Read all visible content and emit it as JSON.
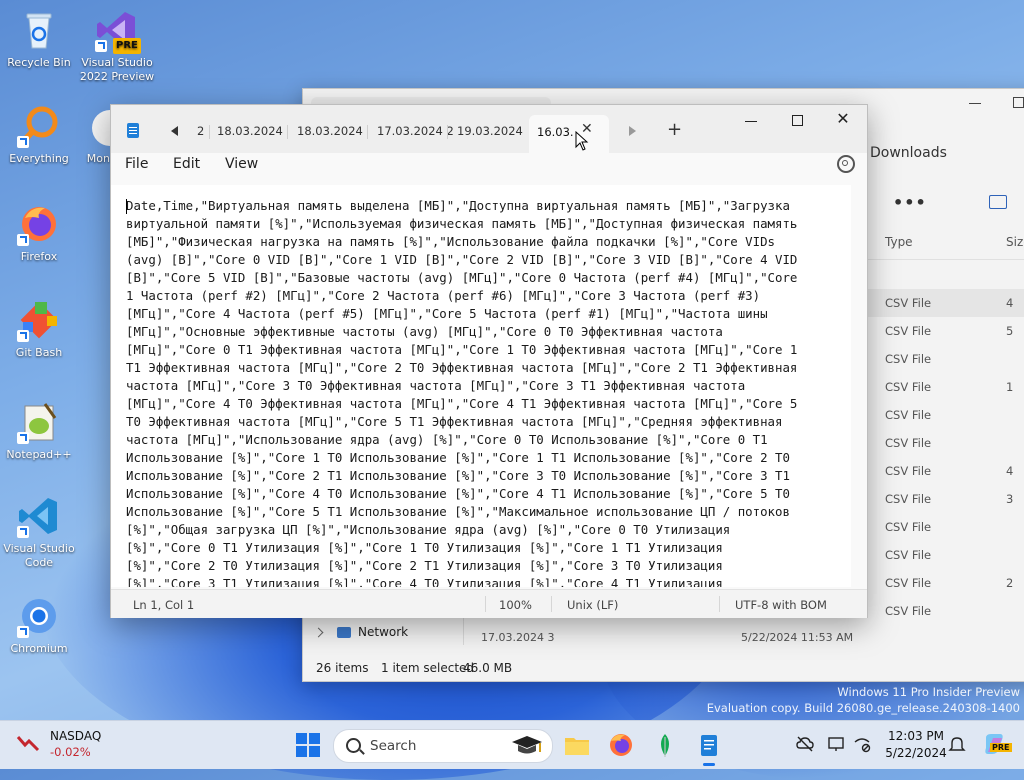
{
  "desktop": {
    "icons": [
      {
        "label": "Recycle Bin"
      },
      {
        "label": "Visual Studio 2022 Preview",
        "badge": "PRE"
      },
      {
        "label": "Everything"
      },
      {
        "label": "Mon"
      },
      {
        "label": "Firefox"
      },
      {
        "label": "Git Bash"
      },
      {
        "label": "Notepad++"
      },
      {
        "label": "Visual Studio Code"
      },
      {
        "label": "Chromium"
      }
    ]
  },
  "explorer": {
    "breadcrumb_location": "Downloads",
    "column_type": "Type",
    "column_size": "Size",
    "rows": [
      {
        "type": "CSV File",
        "size": "4"
      },
      {
        "type": "CSV File",
        "size": "5"
      },
      {
        "type": "CSV File",
        "size": ""
      },
      {
        "type": "CSV File",
        "size": "1"
      },
      {
        "type": "CSV File",
        "size": ""
      },
      {
        "type": "CSV File",
        "size": ""
      },
      {
        "type": "CSV File",
        "size": "4"
      },
      {
        "type": "CSV File",
        "size": "3"
      },
      {
        "type": "CSV File",
        "size": ""
      },
      {
        "type": "CSV File",
        "size": ""
      },
      {
        "type": "CSV File",
        "size": "2"
      },
      {
        "type": "CSV File",
        "size": ""
      }
    ],
    "nav_network": "Network",
    "partial_row": "17.03.2024 3",
    "partial_row_date": "5/22/2024 11:53 AM",
    "status_items": "26 items",
    "status_selected": "1 item selected",
    "status_size": "46.0 MB"
  },
  "notepad": {
    "tabs": [
      {
        "label": "2"
      },
      {
        "label": "18.03.2024"
      },
      {
        "label": "18.03.2024"
      },
      {
        "label": "17.03.2024 2"
      },
      {
        "label": "19.03.2024"
      }
    ],
    "active_tab": "16.03.",
    "close_glyph": "✕",
    "plus_glyph": "+",
    "close_window_glyph": "✕",
    "menu": {
      "file": "File",
      "edit": "Edit",
      "view": "View"
    },
    "content_lines": [
      "Date,Time,\"Виртуальная память выделена [МБ]\",\"Доступна виртуальная память [МБ]\",\"Загрузка",
      "виртуальной памяти [%]\",\"Используемая физическая память [МБ]\",\"Доступная физическая память",
      "[МБ]\",\"Физическая нагрузка на память [%]\",\"Использование файла подкачки [%]\",\"Core VIDs",
      "(avg) [В]\",\"Core 0 VID [В]\",\"Core 1 VID [В]\",\"Core 2 VID [В]\",\"Core 3 VID [В]\",\"Core 4 VID",
      "[В]\",\"Core 5 VID [В]\",\"Базовые частоты (avg) [МГц]\",\"Core 0 Частота (perf #4) [МГц]\",\"Core",
      "1 Частота (perf #2) [МГц]\",\"Core 2 Частота (perf #6) [МГц]\",\"Core 3 Частота (perf #3)",
      "[МГц]\",\"Core 4 Частота (perf #5) [МГц]\",\"Core 5 Частота (perf #1) [МГц]\",\"Частота шины",
      "[МГц]\",\"Основные эффективные частоты (avg) [МГц]\",\"Core 0 T0 Эффективная частота",
      "[МГц]\",\"Core 0 T1 Эффективная частота [МГц]\",\"Core 1 T0 Эффективная частота [МГц]\",\"Core 1",
      "T1 Эффективная частота [МГц]\",\"Core 2 T0 Эффективная частота [МГц]\",\"Core 2 T1 Эффективная",
      "частота [МГц]\",\"Core 3 T0 Эффективная частота [МГц]\",\"Core 3 T1 Эффективная частота",
      "[МГц]\",\"Core 4 T0 Эффективная частота [МГц]\",\"Core 4 T1 Эффективная частота [МГц]\",\"Core 5",
      "T0 Эффективная частота [МГц]\",\"Core 5 T1 Эффективная частота [МГц]\",\"Средняя эффективная",
      "частота [МГц]\",\"Использование ядра (avg) [%]\",\"Core 0 T0 Использование [%]\",\"Core 0 T1",
      "Использование [%]\",\"Core 1 T0 Использование [%]\",\"Core 1 T1 Использование [%]\",\"Core 2 T0",
      "Использование [%]\",\"Core 2 T1 Использование [%]\",\"Core 3 T0 Использование [%]\",\"Core 3 T1",
      "Использование [%]\",\"Core 4 T0 Использование [%]\",\"Core 4 T1 Использование [%]\",\"Core 5 T0",
      "Использование [%]\",\"Core 5 T1 Использование [%]\",\"Максимальное использование ЦП / потоков",
      "[%]\",\"Общая загрузка ЦП [%]\",\"Использование ядра (avg) [%]\",\"Core 0 T0 Утилизация",
      "[%]\",\"Core 0 T1 Утилизация [%]\",\"Core 1 T0 Утилизация [%]\",\"Core 1 T1 Утилизация",
      "[%]\",\"Core 2 T0 Утилизация [%]\",\"Core 2 T1 Утилизация [%]\",\"Core 3 T0 Утилизация",
      "[%]\",\"Core 3 T1 Утилизация [%]\",\"Core 4 T0 Утилизация [%]\",\"Core 4 T1 Утилизация"
    ],
    "status": {
      "position": "Ln 1, Col 1",
      "zoom": "100%",
      "line_ending": "Unix (LF)",
      "encoding": "UTF-8 with BOM"
    }
  },
  "watermark": {
    "line1": "Windows 11 Pro Insider Preview",
    "line2": "Evaluation copy. Build 26080.ge_release.240308-1400"
  },
  "taskbar": {
    "stock_name": "NASDAQ",
    "stock_change": "-0.02%",
    "search_label": "Search",
    "time": "12:03 PM",
    "date": "5/22/2024",
    "copilot_badge": "PRE"
  },
  "colors": {
    "accent": "#1a73e8",
    "stock_down": "#c4262e"
  }
}
